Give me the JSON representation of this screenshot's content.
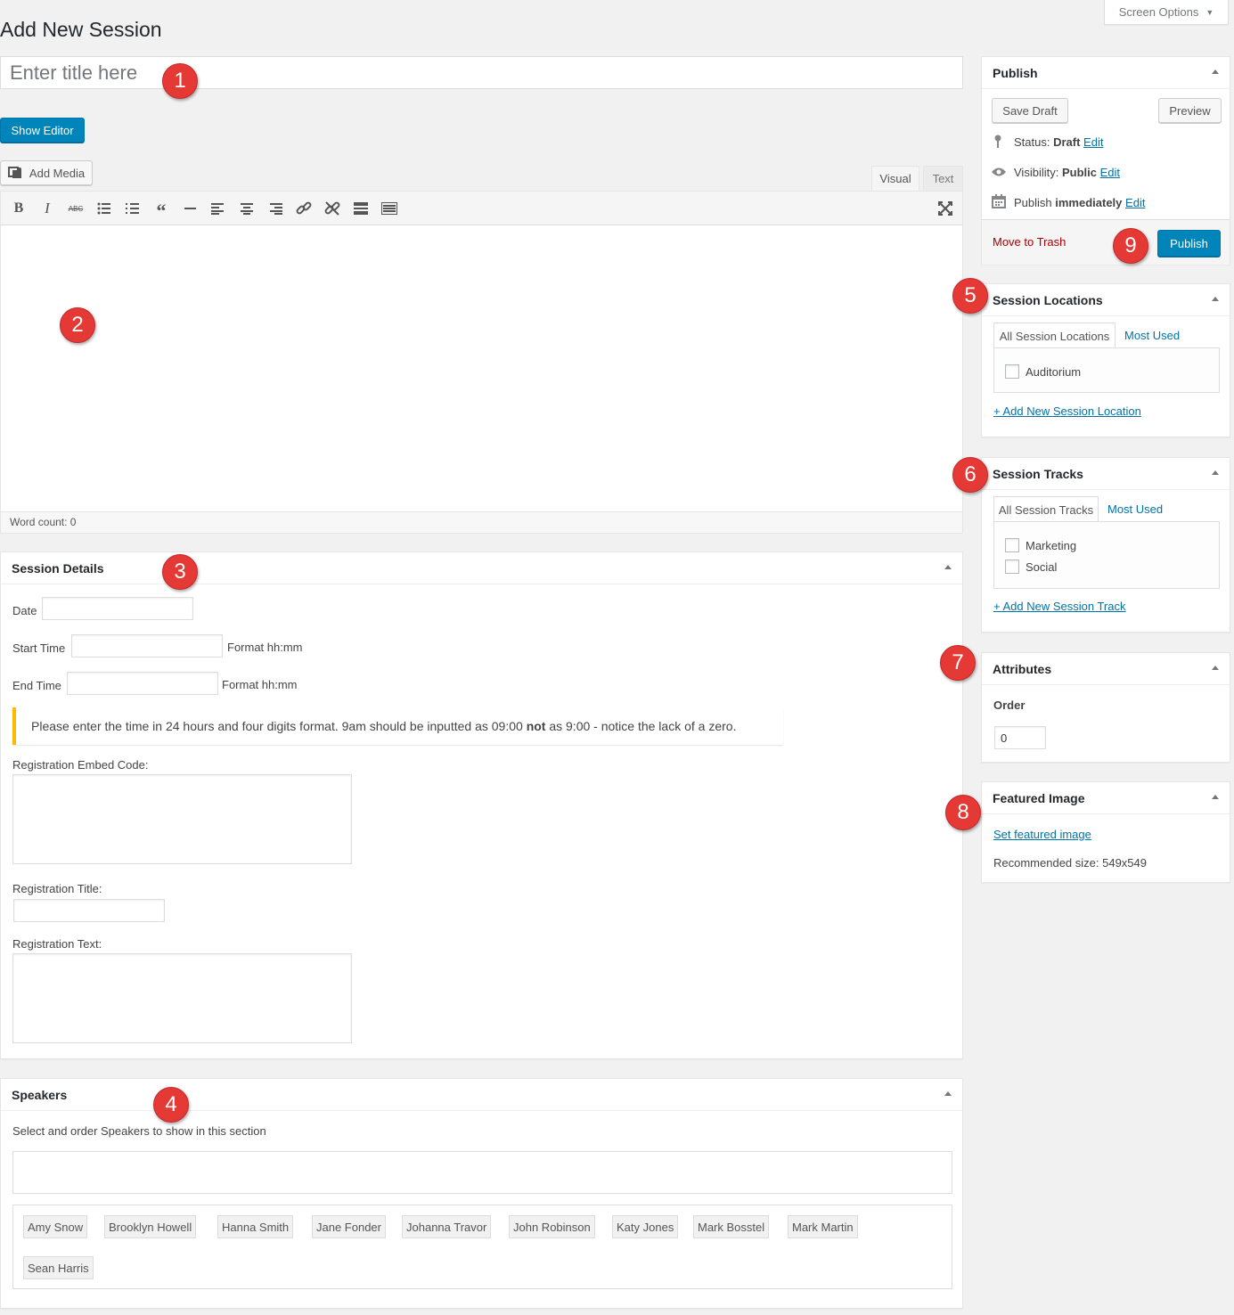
{
  "header": {
    "page_title": "Add New Session",
    "screen_options": "Screen Options"
  },
  "title_field": {
    "placeholder": "Enter title here",
    "value": ""
  },
  "editor": {
    "show_editor_label": "Show Editor",
    "add_media_label": "Add Media",
    "tab_visual": "Visual",
    "tab_text": "Text",
    "toolbar_icons": [
      "bold-icon",
      "italic-icon",
      "strikethrough-icon",
      "bullet-list-icon",
      "numbered-list-icon",
      "blockquote-icon",
      "horizontal-rule-icon",
      "align-left-icon",
      "align-center-icon",
      "align-right-icon",
      "link-icon",
      "unlink-icon",
      "read-more-icon",
      "toolbar-toggle-icon",
      "fullscreen-icon"
    ],
    "word_count": "Word count: 0"
  },
  "session_details": {
    "title": "Session Details",
    "date_label": "Date",
    "start_time_label": "Start Time",
    "end_time_label": "End Time",
    "format_hint": "Format hh:mm",
    "notice_prefix": "Please enter the time in 24 hours and four digits format. 9am should be inputted as 09:00 ",
    "notice_bold": "not",
    "notice_suffix": " as 9:00 - notice the lack of a zero.",
    "reg_embed_label": "Registration Embed Code:",
    "reg_title_label": "Registration Title:",
    "reg_text_label": "Registration Text:"
  },
  "speakers": {
    "title": "Speakers",
    "description": "Select and order Speakers to show in this section",
    "list": [
      "Amy Snow",
      "Brooklyn Howell",
      "Hanna Smith",
      "Jane Fonder",
      "Johanna Travor",
      "John Robinson",
      "Katy Jones",
      "Mark Bosstel",
      "Mark Martin",
      "Sean Harris"
    ]
  },
  "publish": {
    "title": "Publish",
    "save_draft": "Save Draft",
    "preview": "Preview",
    "status_label": "Status: ",
    "status_value": "Draft",
    "visibility_label": "Visibility: ",
    "visibility_value": "Public",
    "publish_label": "Publish ",
    "publish_value": "immediately",
    "edit": "Edit",
    "move_to_trash": "Move to Trash",
    "publish_button": "Publish"
  },
  "session_locations": {
    "title": "Session Locations",
    "tab_all": "All Session Locations",
    "tab_most_used": "Most Used",
    "items": [
      "Auditorium"
    ],
    "add_new": "+ Add New Session Location"
  },
  "session_tracks": {
    "title": "Session Tracks",
    "tab_all": "All Session Tracks",
    "tab_most_used": "Most Used",
    "items": [
      "Marketing",
      "Social"
    ],
    "add_new": "+ Add New Session Track"
  },
  "attributes": {
    "title": "Attributes",
    "order_label": "Order",
    "order_value": "0"
  },
  "featured_image": {
    "title": "Featured Image",
    "set_link": "Set featured image",
    "recommended": "Recommended size: 549x549"
  },
  "markers": [
    "1",
    "2",
    "3",
    "4",
    "5",
    "6",
    "7",
    "8",
    "9"
  ],
  "colors": {
    "primary_button": "#0085ba",
    "link": "#0073aa",
    "trash": "#a00",
    "marker": "#e53935",
    "notice_border": "#ffb900"
  }
}
